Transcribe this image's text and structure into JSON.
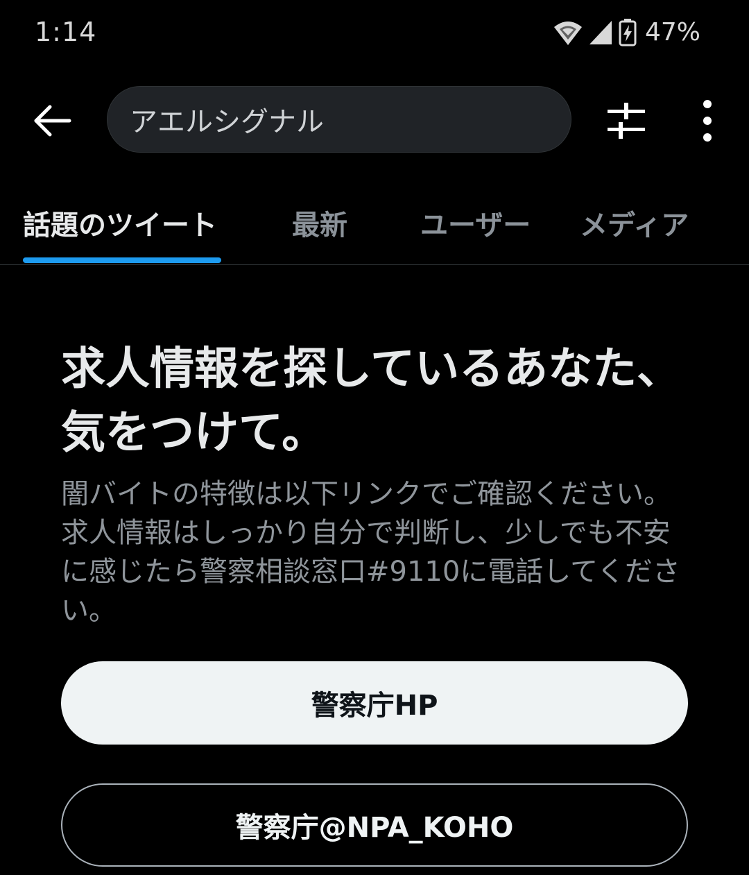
{
  "status_bar": {
    "time": "1:14",
    "battery_percent": "47%",
    "icons": [
      "wifi-icon",
      "cell-signal-icon",
      "battery-charging-icon"
    ]
  },
  "search": {
    "value": "アエルシグナル",
    "back_icon": "arrow-left-icon",
    "filter_icon": "sliders-icon",
    "more_icon": "more-vertical-icon"
  },
  "tabs": [
    {
      "label": "話題のツイート",
      "active": true
    },
    {
      "label": "最新",
      "active": false
    },
    {
      "label": "ユーザー",
      "active": false
    },
    {
      "label": "メディア",
      "active": false
    }
  ],
  "promo": {
    "headline": "求人情報を探しているあなた、気をつけて。",
    "body": "闇バイトの特徴は以下リンクでご確認ください。求人情報はしっかり自分で判断し、少しでも不安に感じたら警察相談窓口#9110に電話してください。",
    "primary_button": "警察庁HP",
    "secondary_button": "警察庁@NPA_KOHO"
  },
  "colors": {
    "background": "#000000",
    "accent": "#1d9bf0",
    "text_primary": "#e7e9ea",
    "text_secondary": "#8f959b",
    "search_fill": "#202327"
  }
}
